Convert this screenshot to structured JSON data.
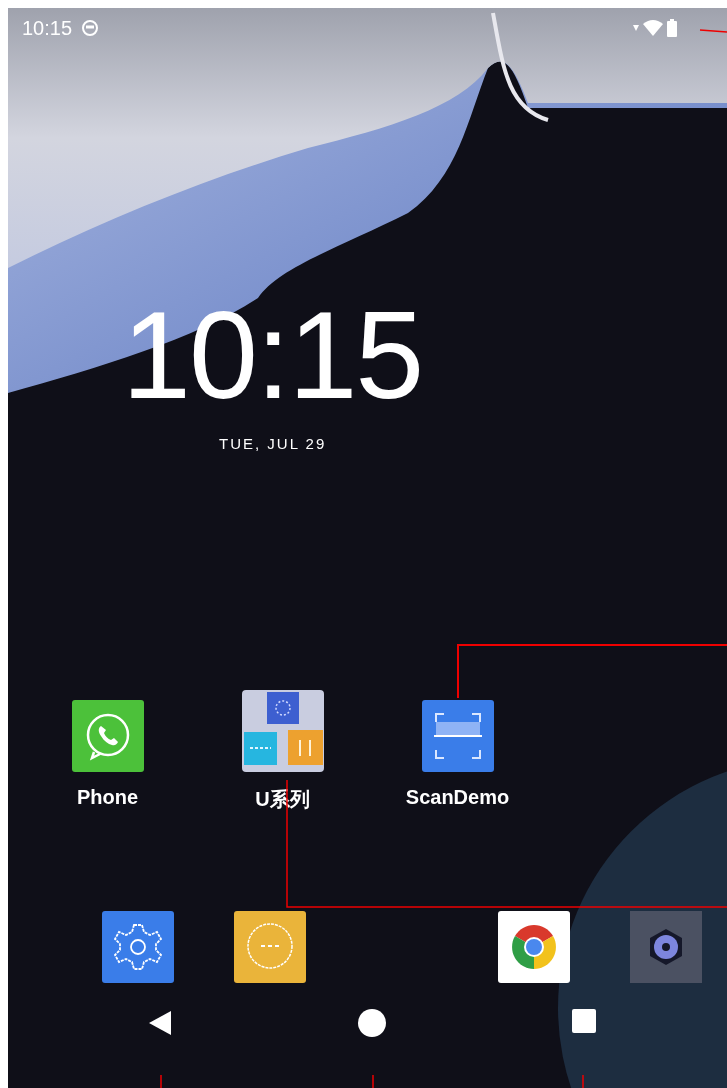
{
  "status_bar": {
    "time": "10:15"
  },
  "clock": {
    "time": "10:15",
    "date": "TUE, JUL 29"
  },
  "apps": [
    {
      "kind": "phone",
      "label": "Phone"
    },
    {
      "kind": "folder",
      "label": "U系列"
    },
    {
      "kind": "scan",
      "label": "ScanDemo"
    }
  ],
  "dock": [
    {
      "kind": "settings"
    },
    {
      "kind": "messages"
    },
    {
      "kind": "browser"
    },
    {
      "kind": "camera"
    }
  ],
  "nav_bar": [
    {
      "kind": "back"
    },
    {
      "kind": "home"
    },
    {
      "kind": "recents"
    }
  ]
}
